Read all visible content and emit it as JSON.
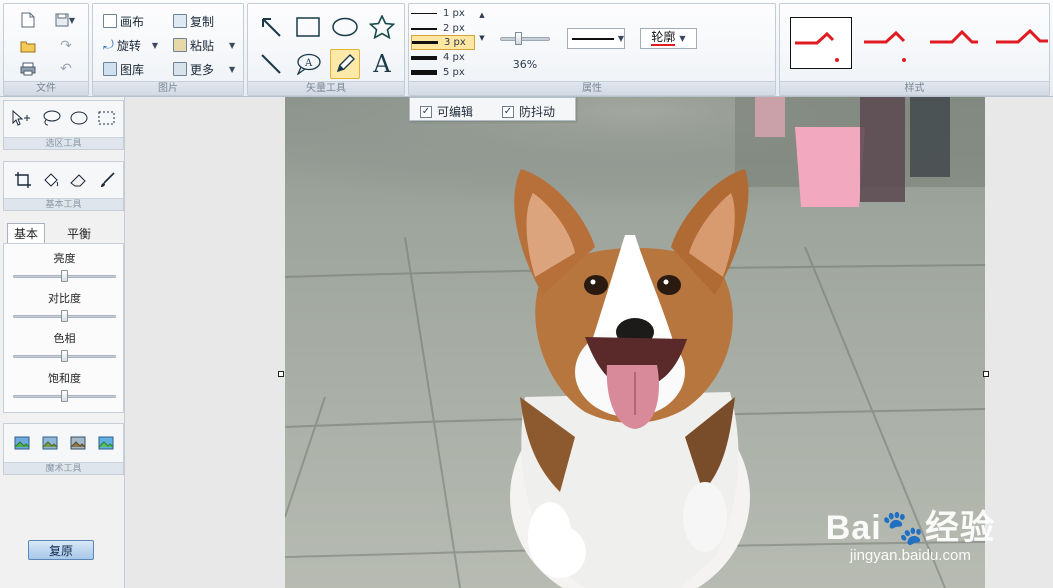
{
  "ribbon": {
    "file": {
      "label": "文件"
    },
    "picture": {
      "label": "图片",
      "canvas": "画布",
      "rotate": "旋转",
      "gallery": "图库",
      "copy": "复制",
      "paste": "粘贴",
      "more": "更多"
    },
    "vector": {
      "label": "矢量工具"
    },
    "properties": {
      "label": "属性",
      "line_widths": [
        "1 px",
        "2 px",
        "3 px",
        "4 px",
        "5 px"
      ],
      "selected_width": "3 px",
      "opacity": "36%",
      "outline": "轮廓"
    },
    "style": {
      "label": "样式"
    }
  },
  "dropdown": {
    "editable": "可编辑",
    "anti_shake": "防抖动"
  },
  "left": {
    "selection_label": "选区工具",
    "basic_tools_label": "基本工具",
    "tabs": [
      "基本",
      "平衡"
    ],
    "sliders": [
      {
        "label": "亮度",
        "value": 0.5
      },
      {
        "label": "对比度",
        "value": 0.5
      },
      {
        "label": "色相",
        "value": 0.5
      },
      {
        "label": "饱和度",
        "value": 0.5
      }
    ],
    "magic_label": "魔术工具",
    "restore": "复原"
  },
  "watermark": {
    "brand": "Bai🐾经验",
    "url": "jingyan.baidu.com"
  },
  "colors": {
    "accent": "#e11b22",
    "ribbon_bg": "#eef2f6",
    "selected": "#ffe7a3"
  }
}
